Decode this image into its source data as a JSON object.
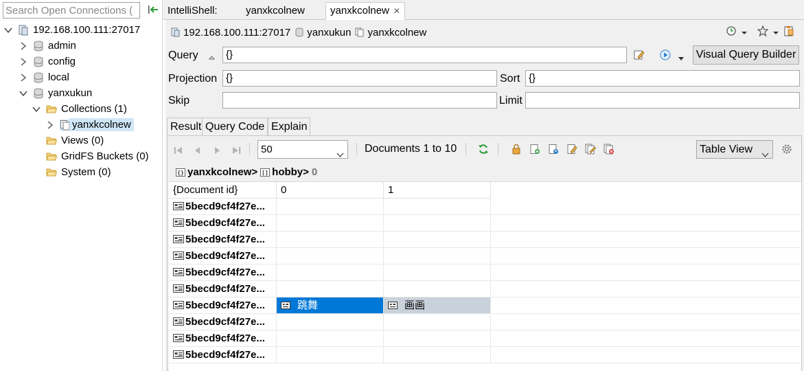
{
  "left_panel": {
    "search_placeholder": "Search Open Connections (",
    "tree": [
      {
        "label": "192.168.100.111:27017",
        "icon": "server-icon",
        "expanded": true,
        "indent": 0
      },
      {
        "label": "admin",
        "icon": "database-icon",
        "expanded": false,
        "indent": 1
      },
      {
        "label": "config",
        "icon": "database-icon",
        "expanded": false,
        "indent": 1
      },
      {
        "label": "local",
        "icon": "database-icon",
        "expanded": false,
        "indent": 1
      },
      {
        "label": "yanxukun",
        "icon": "database-icon",
        "expanded": true,
        "indent": 1
      },
      {
        "label": "Collections (1)",
        "icon": "folder-icon",
        "expanded": true,
        "indent": 2
      },
      {
        "label": "yanxkcolnew",
        "icon": "collection-icon",
        "expanded": false,
        "indent": 3,
        "selected": true
      },
      {
        "label": "Views (0)",
        "icon": "folder-icon",
        "indent": 2
      },
      {
        "label": "GridFS Buckets (0)",
        "icon": "folder-icon",
        "indent": 2
      },
      {
        "label": "System (0)",
        "icon": "folder-icon",
        "indent": 2
      }
    ]
  },
  "tabs": [
    {
      "label": "IntelliShell:",
      "active": false
    },
    {
      "label": "yanxkcolnew",
      "active": false
    },
    {
      "label": "yanxkcolnew",
      "active": true
    }
  ],
  "path": {
    "server": "192.168.100.111:27017",
    "database": "yanxukun",
    "collection": "yanxkcolnew"
  },
  "query": {
    "query_label": "Query",
    "query_value": "{}",
    "projection_label": "Projection",
    "projection_value": "{}",
    "sort_label": "Sort",
    "sort_value": "{}",
    "skip_label": "Skip",
    "skip_value": "",
    "limit_label": "Limit",
    "limit_value": "",
    "vqb_label": "Visual Query Builder"
  },
  "result_tabs": [
    {
      "label": "Result",
      "active": true
    },
    {
      "label": "Query Code",
      "active": false
    },
    {
      "label": "Explain",
      "active": false
    }
  ],
  "toolbar": {
    "page_size": "50",
    "documents_text": "Documents 1 to 10",
    "view_mode": "Table View"
  },
  "breadcrumb": {
    "collection": "yanxkcolnew",
    "sep": ">",
    "field": "hobby",
    "count": "0"
  },
  "grid": {
    "columns": [
      "{Document id}",
      "0",
      "1"
    ],
    "rows": [
      {
        "id": "5becd9cf4f27e...",
        "c0": "",
        "c1": ""
      },
      {
        "id": "5becd9cf4f27e...",
        "c0": "",
        "c1": ""
      },
      {
        "id": "5becd9cf4f27e...",
        "c0": "",
        "c1": ""
      },
      {
        "id": "5becd9cf4f27e...",
        "c0": "",
        "c1": ""
      },
      {
        "id": "5becd9cf4f27e...",
        "c0": "",
        "c1": ""
      },
      {
        "id": "5becd9cf4f27e...",
        "c0": "",
        "c1": ""
      },
      {
        "id": "5becd9cf4f27e...",
        "c0": "跳舞",
        "c1": "画画",
        "selected": true
      },
      {
        "id": "5becd9cf4f27e...",
        "c0": "",
        "c1": ""
      },
      {
        "id": "5becd9cf4f27e...",
        "c0": "",
        "c1": ""
      },
      {
        "id": "5becd9cf4f27e...",
        "c0": "",
        "c1": ""
      }
    ]
  },
  "colors": {
    "selection": "#0078d7",
    "selection_secondary": "#c9d2db",
    "tree_selection": "#cfe6f7",
    "panel_bg": "#f0f0f0"
  }
}
